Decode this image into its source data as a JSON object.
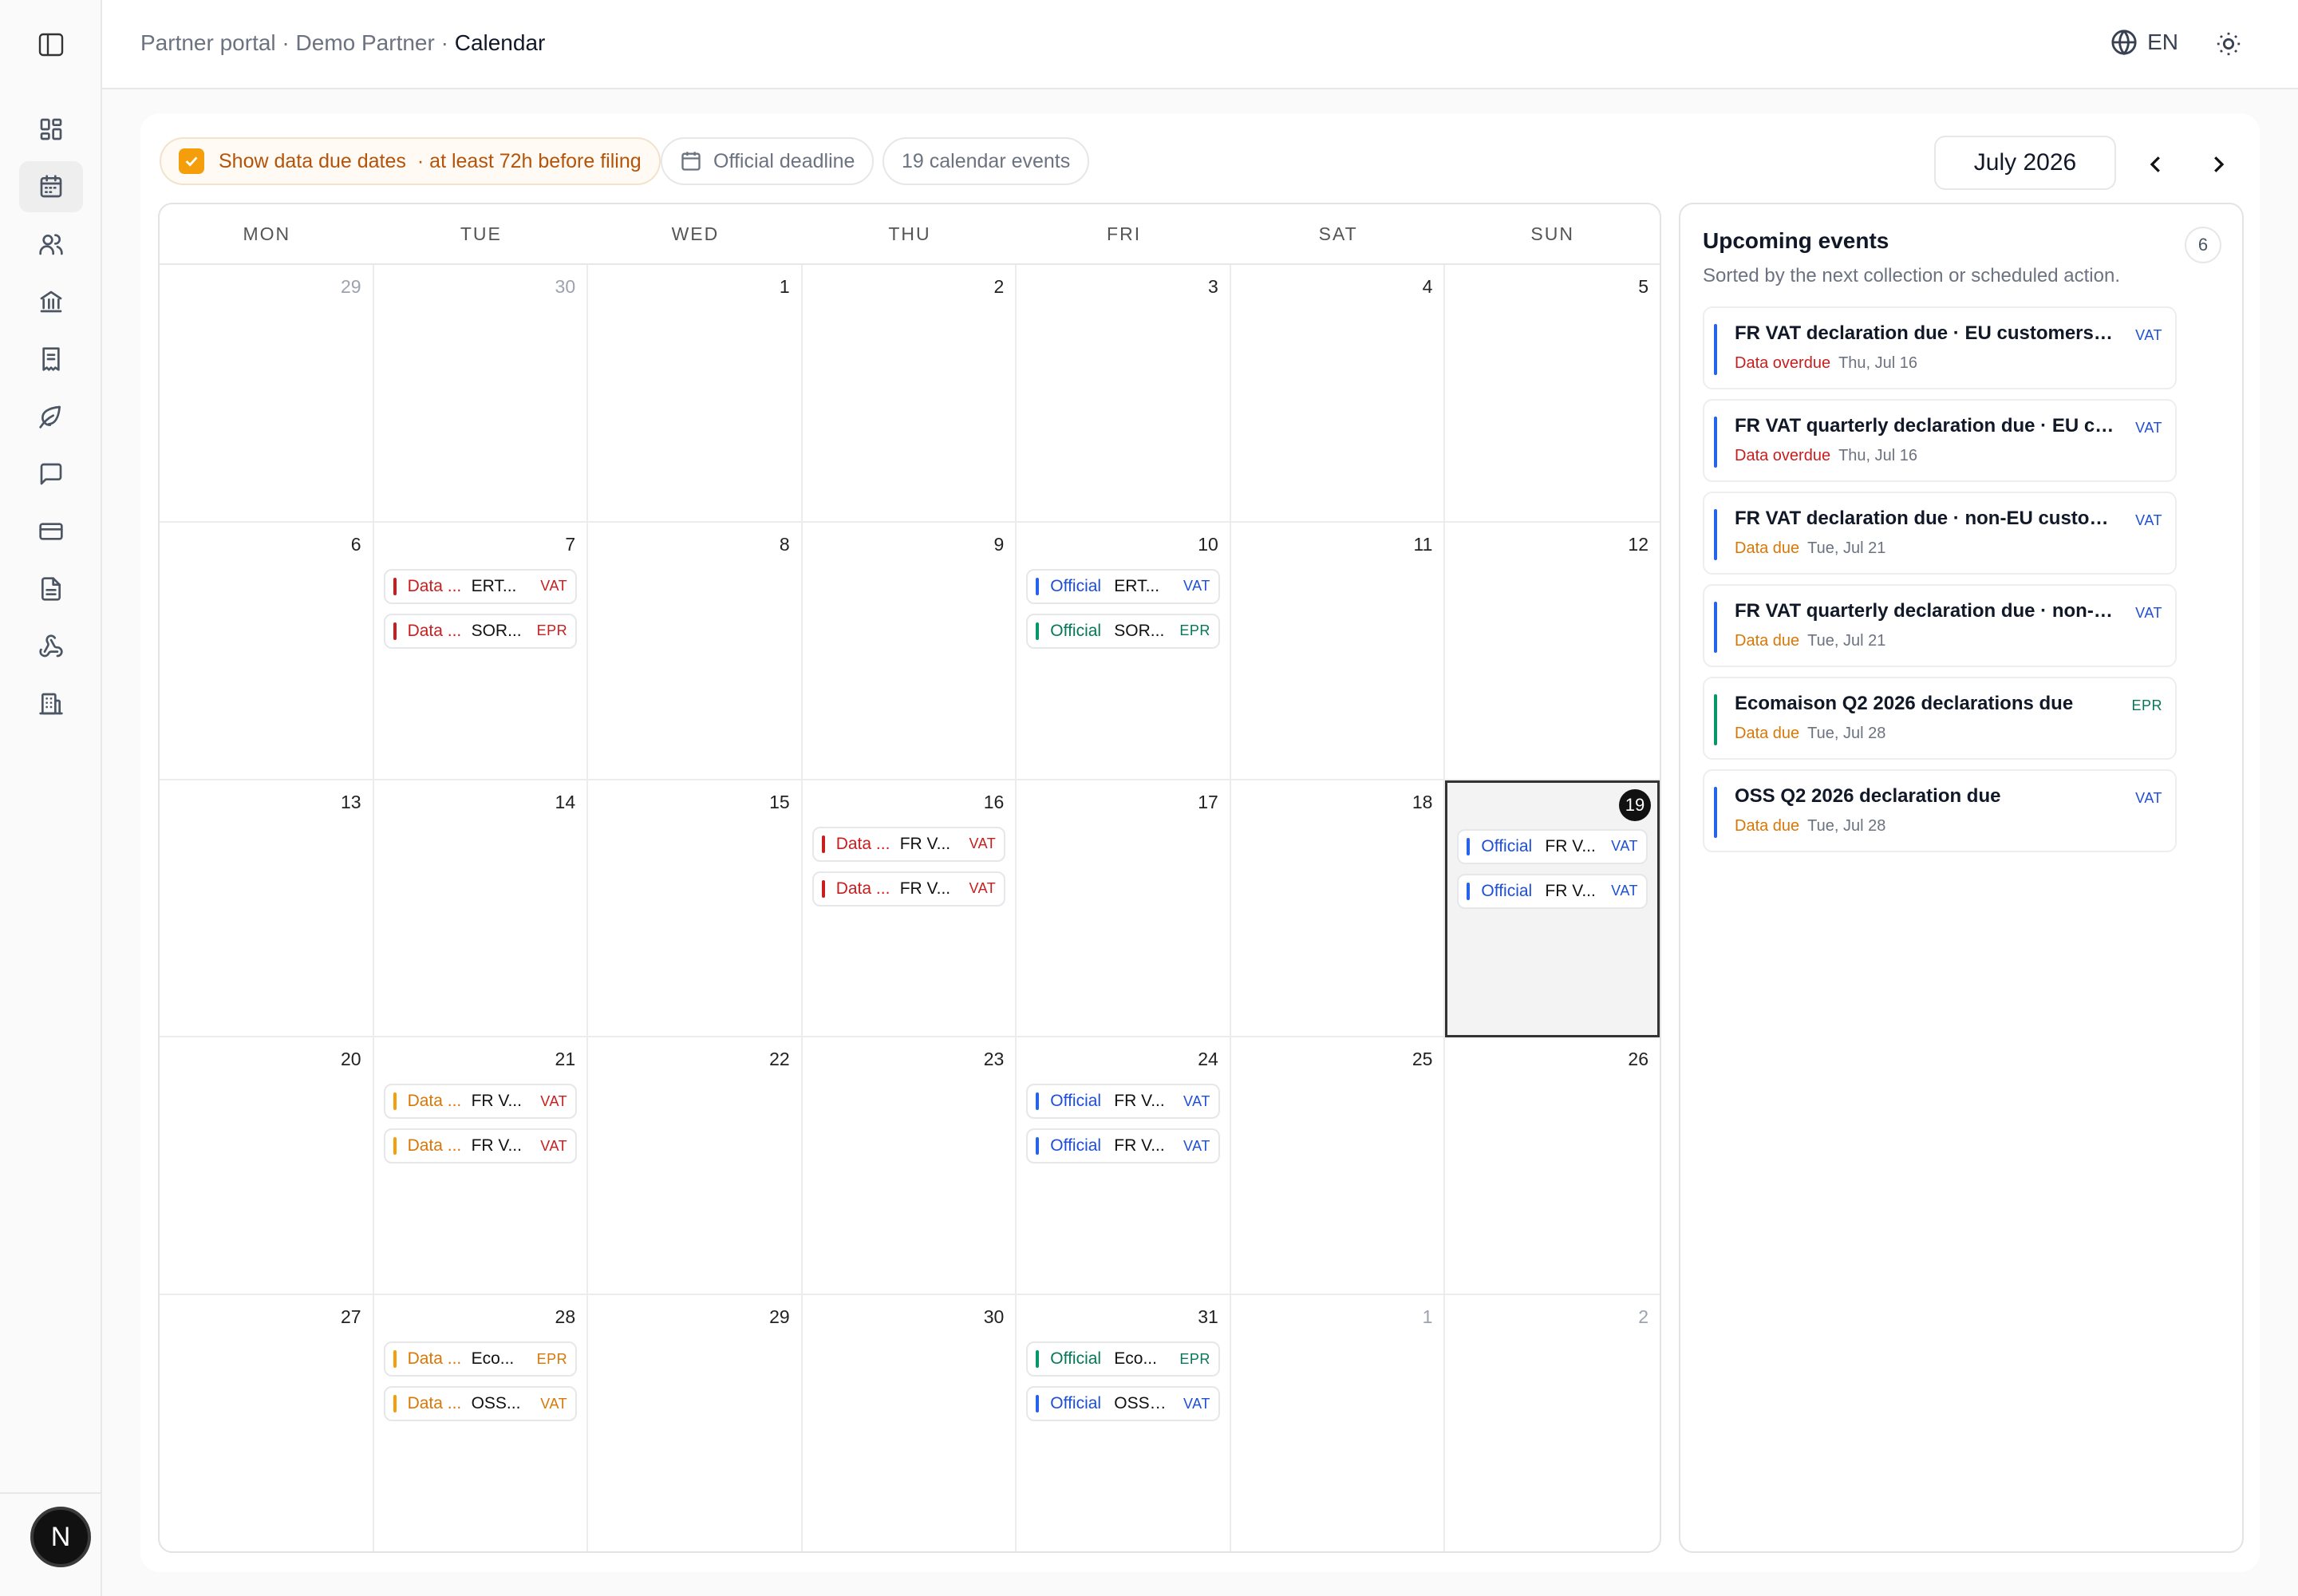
{
  "breadcrumb": {
    "root": "Partner portal",
    "partner": "Demo Partner",
    "current": "Calendar",
    "separator": "·"
  },
  "header": {
    "language": "EN"
  },
  "sidebar": {
    "avatar_initial": "N",
    "icons": [
      "dashboard-icon",
      "calendar-icon",
      "users-icon",
      "bank-icon",
      "receipt-icon",
      "leaf-icon",
      "message-icon",
      "credit-card-icon",
      "document-icon",
      "webhook-icon",
      "building-icon"
    ],
    "active_index": 1
  },
  "toolbar": {
    "show_data_due_label": "Show data due dates",
    "show_data_due_hint": "· at least 72h before filing",
    "show_data_due_checked": true,
    "deadline_label": "Official deadline",
    "events_count_label": "19 calendar events",
    "month_label": "July 2026"
  },
  "weekdays": [
    "MON",
    "TUE",
    "WED",
    "THU",
    "FRI",
    "SAT",
    "SUN"
  ],
  "colors": {
    "data_overdue": "#c81e1e",
    "data_due": "#d97706",
    "vat": "#1d4ed8",
    "epr": "#047857",
    "official_vat": "#2563eb",
    "official_epr": "#059669"
  },
  "weeks": [
    [
      {
        "d": "29",
        "out": true
      },
      {
        "d": "30",
        "out": true
      },
      {
        "d": "1"
      },
      {
        "d": "2"
      },
      {
        "d": "3"
      },
      {
        "d": "4"
      },
      {
        "d": "5"
      }
    ],
    [
      {
        "d": "6"
      },
      {
        "d": "7",
        "events": [
          {
            "kind": "Data ...",
            "title": "ERT...",
            "tag": "VAT",
            "kc": "red",
            "tc": "red"
          },
          {
            "kind": "Data ...",
            "title": "SOR...",
            "tag": "EPR",
            "kc": "red",
            "tc": "red"
          }
        ]
      },
      {
        "d": "8"
      },
      {
        "d": "9"
      },
      {
        "d": "10",
        "events": [
          {
            "kind": "Official",
            "title": "ERT...",
            "tag": "VAT",
            "kc": "blue",
            "tc": "blue"
          },
          {
            "kind": "Official",
            "title": "SOR...",
            "tag": "EPR",
            "kc": "green",
            "tc": "green"
          }
        ]
      },
      {
        "d": "11"
      },
      {
        "d": "12"
      }
    ],
    [
      {
        "d": "13"
      },
      {
        "d": "14"
      },
      {
        "d": "15"
      },
      {
        "d": "16",
        "events": [
          {
            "kind": "Data ...",
            "title": "FR V...",
            "tag": "VAT",
            "kc": "red",
            "tc": "red"
          },
          {
            "kind": "Data ...",
            "title": "FR V...",
            "tag": "VAT",
            "kc": "red",
            "tc": "red"
          }
        ]
      },
      {
        "d": "17"
      },
      {
        "d": "18"
      },
      {
        "d": "19",
        "today": true,
        "events": [
          {
            "kind": "Official",
            "title": "FR V...",
            "tag": "VAT",
            "kc": "blue",
            "tc": "blue"
          },
          {
            "kind": "Official",
            "title": "FR V...",
            "tag": "VAT",
            "kc": "blue",
            "tc": "blue"
          }
        ]
      }
    ],
    [
      {
        "d": "20"
      },
      {
        "d": "21",
        "events": [
          {
            "kind": "Data ...",
            "title": "FR V...",
            "tag": "VAT",
            "kc": "orange",
            "tc": "red"
          },
          {
            "kind": "Data ...",
            "title": "FR V...",
            "tag": "VAT",
            "kc": "orange",
            "tc": "red"
          }
        ]
      },
      {
        "d": "22"
      },
      {
        "d": "23"
      },
      {
        "d": "24",
        "events": [
          {
            "kind": "Official",
            "title": "FR V...",
            "tag": "VAT",
            "kc": "blue",
            "tc": "blue"
          },
          {
            "kind": "Official",
            "title": "FR V...",
            "tag": "VAT",
            "kc": "blue",
            "tc": "blue"
          }
        ]
      },
      {
        "d": "25"
      },
      {
        "d": "26"
      }
    ],
    [
      {
        "d": "27"
      },
      {
        "d": "28",
        "events": [
          {
            "kind": "Data ...",
            "title": "Eco...",
            "tag": "EPR",
            "kc": "orange",
            "tc": "orange"
          },
          {
            "kind": "Data ...",
            "title": "OSS...",
            "tag": "VAT",
            "kc": "orange",
            "tc": "orange"
          }
        ]
      },
      {
        "d": "29"
      },
      {
        "d": "30"
      },
      {
        "d": "31",
        "events": [
          {
            "kind": "Official",
            "title": "Eco...",
            "tag": "EPR",
            "kc": "green",
            "tc": "green"
          },
          {
            "kind": "Official",
            "title": "OSS ...",
            "tag": "VAT",
            "kc": "blue",
            "tc": "blue"
          }
        ]
      },
      {
        "d": "1",
        "out": true
      },
      {
        "d": "2",
        "out": true
      }
    ]
  ],
  "upcoming": {
    "title": "Upcoming events",
    "subtitle": "Sorted by the next collection or scheduled action.",
    "count": "6",
    "items": [
      {
        "title": "FR VAT declaration due · EU customers (pe...",
        "status": "Data overdue",
        "date": "Thu, Jul 16",
        "tag": "VAT",
        "sc": "red",
        "bar": "blue",
        "tc": "blue"
      },
      {
        "title": "FR VAT quarterly declaration due · EU cust...",
        "status": "Data overdue",
        "date": "Thu, Jul 16",
        "tag": "VAT",
        "sc": "red",
        "bar": "blue",
        "tc": "blue"
      },
      {
        "title": "FR VAT declaration due · non-EU customer...",
        "status": "Data due",
        "date": "Tue, Jul 21",
        "tag": "VAT",
        "sc": "orange",
        "bar": "blue",
        "tc": "blue"
      },
      {
        "title": "FR VAT quarterly declaration due · non-EU ...",
        "status": "Data due",
        "date": "Tue, Jul 21",
        "tag": "VAT",
        "sc": "orange",
        "bar": "blue",
        "tc": "blue"
      },
      {
        "title": "Ecomaison Q2 2026 declarations due",
        "status": "Data due",
        "date": "Tue, Jul 28",
        "tag": "EPR",
        "sc": "orange",
        "bar": "green",
        "tc": "green"
      },
      {
        "title": "OSS Q2 2026 declaration due",
        "status": "Data due",
        "date": "Tue, Jul 28",
        "tag": "VAT",
        "sc": "orange",
        "bar": "blue",
        "tc": "blue"
      }
    ]
  }
}
